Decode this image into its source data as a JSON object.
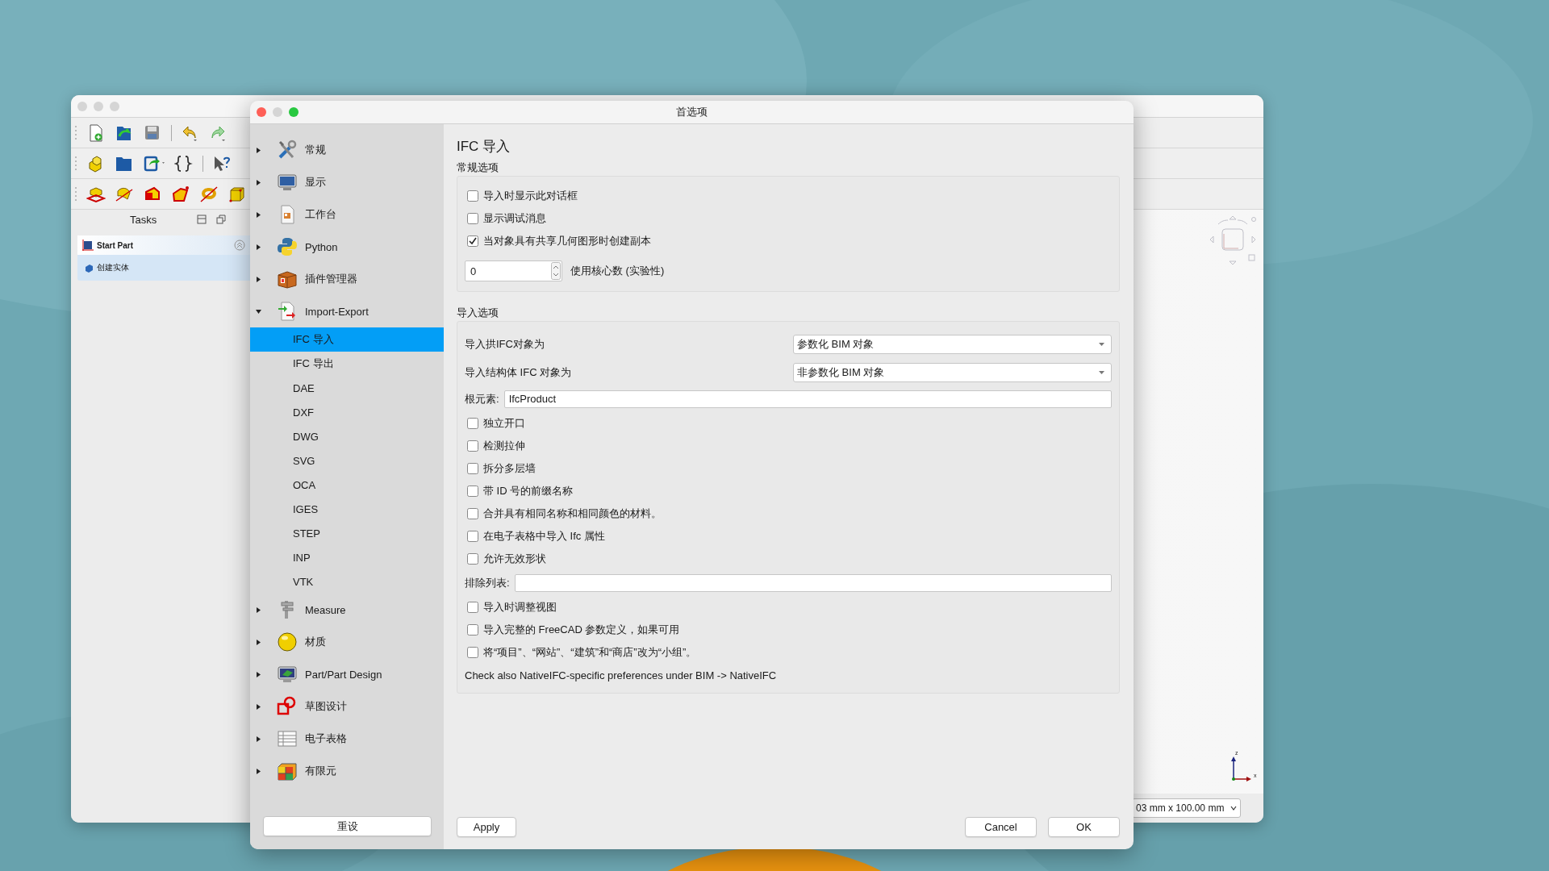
{
  "main_window": {
    "tasks_title": "Tasks",
    "task_panel": {
      "title": "Start Part",
      "items": [
        "创建实体"
      ]
    },
    "axis_labels": [
      "z",
      "x"
    ],
    "status_combo": "03 mm x 100.00 mm"
  },
  "dialog": {
    "title": "首选项",
    "sidebar": [
      {
        "label": "常规",
        "expanded": false
      },
      {
        "label": "显示",
        "expanded": false
      },
      {
        "label": "工作台",
        "expanded": false
      },
      {
        "label": "Python",
        "expanded": false
      },
      {
        "label": "插件管理器",
        "expanded": false
      },
      {
        "label": "Import-Export",
        "expanded": true,
        "children": [
          {
            "label": "IFC 导入",
            "selected": true
          },
          {
            "label": "IFC 导出",
            "selected": false
          },
          {
            "label": "DAE",
            "selected": false
          },
          {
            "label": "DXF",
            "selected": false
          },
          {
            "label": "DWG",
            "selected": false
          },
          {
            "label": "SVG",
            "selected": false
          },
          {
            "label": "OCA",
            "selected": false
          },
          {
            "label": "IGES",
            "selected": false
          },
          {
            "label": "STEP",
            "selected": false
          },
          {
            "label": "INP",
            "selected": false
          },
          {
            "label": "VTK",
            "selected": false
          }
        ]
      },
      {
        "label": "Measure",
        "expanded": false
      },
      {
        "label": "材质",
        "expanded": false
      },
      {
        "label": "Part/Part Design",
        "expanded": false
      },
      {
        "label": "草图设计",
        "expanded": false
      },
      {
        "label": "电子表格",
        "expanded": false
      },
      {
        "label": "有限元",
        "expanded": false
      }
    ],
    "reset_button": "重设",
    "page_title": "IFC 导入",
    "groups": [
      {
        "title": "常规选项",
        "rows": [
          {
            "kind": "checkbox",
            "label": "导入时显示此对话框",
            "checked": false
          },
          {
            "kind": "checkbox",
            "label": "显示调试消息",
            "checked": false
          },
          {
            "kind": "checkbox",
            "label": "当对象具有共享几何图形时创建副本",
            "checked": true
          },
          {
            "kind": "spinbox",
            "value": "0",
            "caption": "使用核心数 (实验性)"
          }
        ]
      },
      {
        "title": "导入选项",
        "rows": [
          {
            "kind": "combo",
            "label": "导入拱IFC对象为",
            "value": "参数化 BIM 对象"
          },
          {
            "kind": "combo",
            "label": "导入结构体 IFC 对象为",
            "value": "非参数化 BIM 对象"
          },
          {
            "kind": "text",
            "label": "根元素:",
            "value": "IfcProduct"
          },
          {
            "kind": "checkbox",
            "label": "独立开口",
            "checked": false
          },
          {
            "kind": "checkbox",
            "label": "检测拉伸",
            "checked": false
          },
          {
            "kind": "checkbox",
            "label": "拆分多层墙",
            "checked": false
          },
          {
            "kind": "checkbox",
            "label": "带 ID 号的前缀名称",
            "checked": false
          },
          {
            "kind": "checkbox",
            "label": "合并具有相同名称和相同颜色的材料。",
            "checked": false
          },
          {
            "kind": "checkbox",
            "label": "在电子表格中导入 Ifc 属性",
            "checked": false
          },
          {
            "kind": "checkbox",
            "label": "允许无效形状",
            "checked": false
          },
          {
            "kind": "text",
            "label": "排除列表:"
          },
          {
            "kind": "checkbox",
            "label": "导入时调整视图",
            "checked": false
          },
          {
            "kind": "checkbox",
            "label": "导入完整的 FreeCAD 参数定义，如果可用",
            "checked": false
          },
          {
            "kind": "checkbox",
            "label": "将“项目”、“网站”、“建筑”和“商店”改为“小组”。",
            "checked": false
          },
          {
            "kind": "note",
            "text": "Check also NativeIFC-specific preferences under BIM -> NativeIFC"
          }
        ]
      }
    ],
    "buttons": [
      {
        "kind": "apply",
        "label": "Apply"
      },
      {
        "kind": "cancel",
        "label": "Cancel"
      },
      {
        "kind": "ok",
        "label": "OK"
      }
    ]
  }
}
